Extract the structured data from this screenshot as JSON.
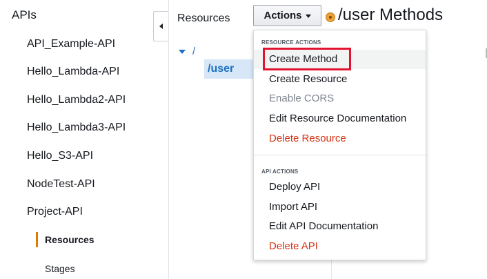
{
  "sidebar": {
    "title": "APIs",
    "apis": [
      "API_Example-API",
      "Hello_Lambda-API",
      "Hello_Lambda2-API",
      "Hello_Lambda3-API",
      "Hello_S3-API",
      "NodeTest-API",
      "Project-API"
    ],
    "subnav": [
      {
        "label": "Resources",
        "active": true
      },
      {
        "label": "Stages",
        "active": false
      }
    ],
    "accent_color": "#e07b00"
  },
  "resources": {
    "title": "Resources",
    "actions_label": "Actions",
    "tree_root": "/",
    "tree_selected": "/user"
  },
  "method_header": {
    "title": "/user Methods",
    "icon": "resource-badge-icon"
  },
  "dropdown": {
    "resource_section": "RESOURCE ACTIONS",
    "resource_actions": [
      {
        "label": "Create Method",
        "state": "highlighted"
      },
      {
        "label": "Create Resource",
        "state": "normal"
      },
      {
        "label": "Enable CORS",
        "state": "disabled"
      },
      {
        "label": "Edit Resource Documentation",
        "state": "normal"
      },
      {
        "label": "Delete Resource",
        "state": "danger"
      }
    ],
    "api_section": "API ACTIONS",
    "api_actions": [
      {
        "label": "Deploy API",
        "state": "normal"
      },
      {
        "label": "Import API",
        "state": "normal"
      },
      {
        "label": "Edit API Documentation",
        "state": "normal"
      },
      {
        "label": "Delete API",
        "state": "danger"
      }
    ],
    "danger_color": "#d13212",
    "highlight_color": "#e2132f"
  }
}
